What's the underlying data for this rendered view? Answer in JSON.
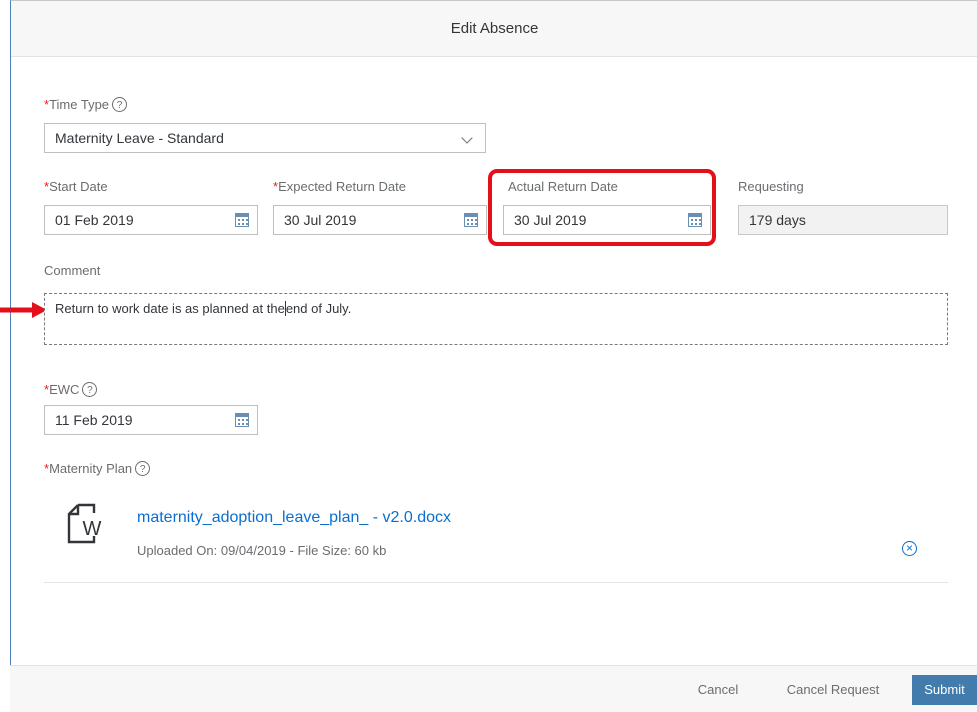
{
  "dialog": {
    "title": "Edit Absence"
  },
  "time_type": {
    "label": "Time Type",
    "value": "Maternity Leave - Standard"
  },
  "start_date": {
    "label": "Start Date",
    "value": "01 Feb 2019"
  },
  "expected_return": {
    "label": "Expected Return Date",
    "value": "30 Jul 2019"
  },
  "actual_return": {
    "label": "Actual Return Date",
    "value": "30 Jul 2019"
  },
  "requesting": {
    "label": "Requesting",
    "value": "179 days"
  },
  "comment": {
    "label": "Comment",
    "text_before_cursor": "Return to work date is as planned at the",
    "text_after_cursor": "end of July."
  },
  "ewc": {
    "label": "EWC",
    "value": "11 Feb 2019"
  },
  "maternity_plan": {
    "label": "Maternity Plan",
    "file_name": "maternity_adoption_leave_plan_ - v2.0.docx",
    "uploaded_on_label": "Uploaded On: 09/04/2019",
    "separator": " - ",
    "file_size_label": "File Size: 60 kb",
    "file_icon_letter": "W"
  },
  "required_marker": "*",
  "help_glyph": "?",
  "footer": {
    "cancel": "Cancel",
    "cancel_request": "Cancel Request",
    "submit": "Submit"
  },
  "colors": {
    "accent": "#0a6ed1",
    "primary_button": "#427cac",
    "required": "#e9201e",
    "highlight": "#e3101c"
  }
}
